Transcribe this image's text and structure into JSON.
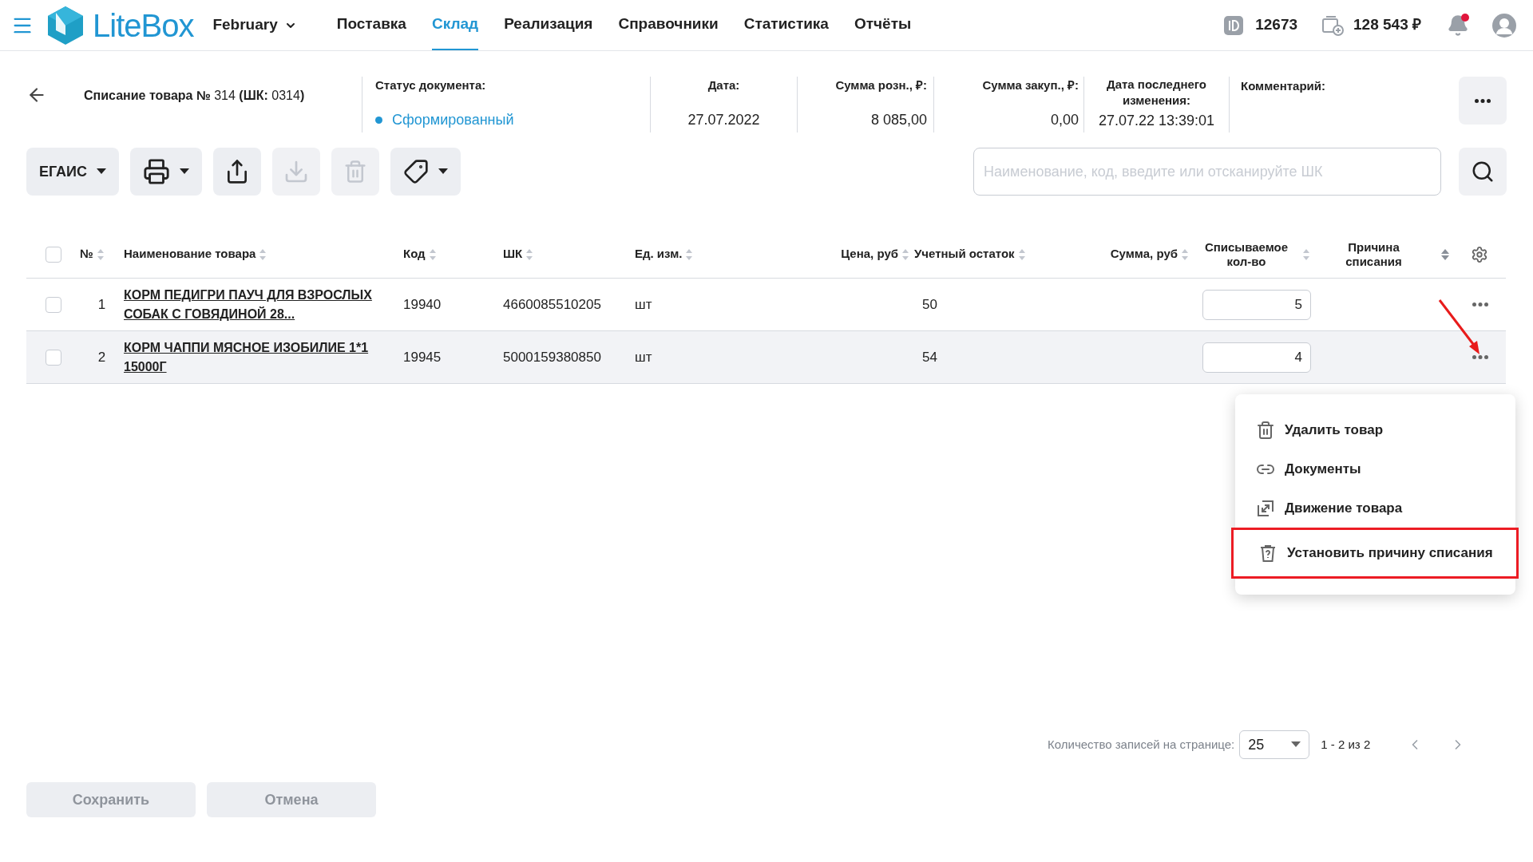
{
  "topbar": {
    "logo": "LiteBox",
    "store": "February",
    "nav": [
      {
        "label": "Поставка",
        "selected": false
      },
      {
        "label": "Склад",
        "selected": true
      },
      {
        "label": "Реализация",
        "selected": false
      },
      {
        "label": "Справочники",
        "selected": false
      },
      {
        "label": "Статистика",
        "selected": false
      },
      {
        "label": "Отчёты",
        "selected": false
      }
    ],
    "account_id": "12673",
    "balance": "128 543 ₽",
    "has_notifications": true
  },
  "document": {
    "title": "**Списание товара №** 314 **(ШК:** 0314**)**",
    "status": {
      "label": "Статус документа:",
      "value": "Сформированный",
      "color": "#2196d3"
    },
    "date": {
      "label": "Дата:",
      "value": "27.07.2022"
    },
    "retail_sum": {
      "label": "Сумма розн., ₽:",
      "value": "8 085,00"
    },
    "purchase_sum": {
      "label": "Сумма закуп., ₽:",
      "value": "0,00"
    },
    "last_modified": {
      "label": "Дата последнего изменения:",
      "value": "27.07.22 13:39:01"
    },
    "comment": {
      "label": "Комментарий:"
    }
  },
  "toolbar": [
    {
      "kind": "egais",
      "label": "ЕГАИС",
      "disabled": false
    },
    {
      "kind": "print",
      "disabled": false
    },
    {
      "kind": "export",
      "disabled": false
    },
    {
      "kind": "import",
      "disabled": true
    },
    {
      "kind": "delete",
      "disabled": true
    },
    {
      "kind": "tag",
      "disabled": false
    }
  ],
  "search": {
    "placeholder": "Наименование, код, введите или отсканируйте ШК"
  },
  "table": {
    "all_checked": false,
    "columns": [
      "№",
      "Наименование товара",
      "Код",
      "ШК",
      "Ед. изм.",
      "Цена, руб",
      "Учетный остаток",
      "Сумма, руб",
      "Списываемое кол-во",
      "Причина списания"
    ],
    "rows": [
      {
        "checked": false,
        "selected": false,
        "number": "1",
        "name": "КОРМ ПЕДИГРИ ПАУЧ ДЛЯ ВЗРОСЛЫХ СОБАК С ГОВЯДИНОЙ 28...",
        "code": "19940",
        "barcode": "4660085510205",
        "unit": "шт",
        "stock": "50",
        "quantity": "5"
      },
      {
        "checked": false,
        "selected": true,
        "number": "2",
        "name": "КОРМ ЧАППИ МЯСНОЕ ИЗОБИЛИЕ 1*1 15000Г",
        "code": "19945",
        "barcode": "5000159380850",
        "unit": "шт",
        "stock": "54",
        "quantity": "4"
      }
    ]
  },
  "context_menu": [
    {
      "kind": "delete",
      "label": "Удалить товар",
      "highlighted": false
    },
    {
      "kind": "link",
      "label": "Документы",
      "highlighted": false
    },
    {
      "kind": "movement",
      "label": "Движение товара",
      "highlighted": false
    },
    {
      "kind": "reason",
      "label": "Установить причину списания",
      "highlighted": true
    }
  ],
  "pagination": {
    "label": "Количество записей на странице:",
    "page_size": "25",
    "range": "1 - 2 из 2"
  },
  "buttons": [
    {
      "label": "Сохранить",
      "disabled": true
    },
    {
      "label": "Отмена",
      "disabled": true
    }
  ]
}
